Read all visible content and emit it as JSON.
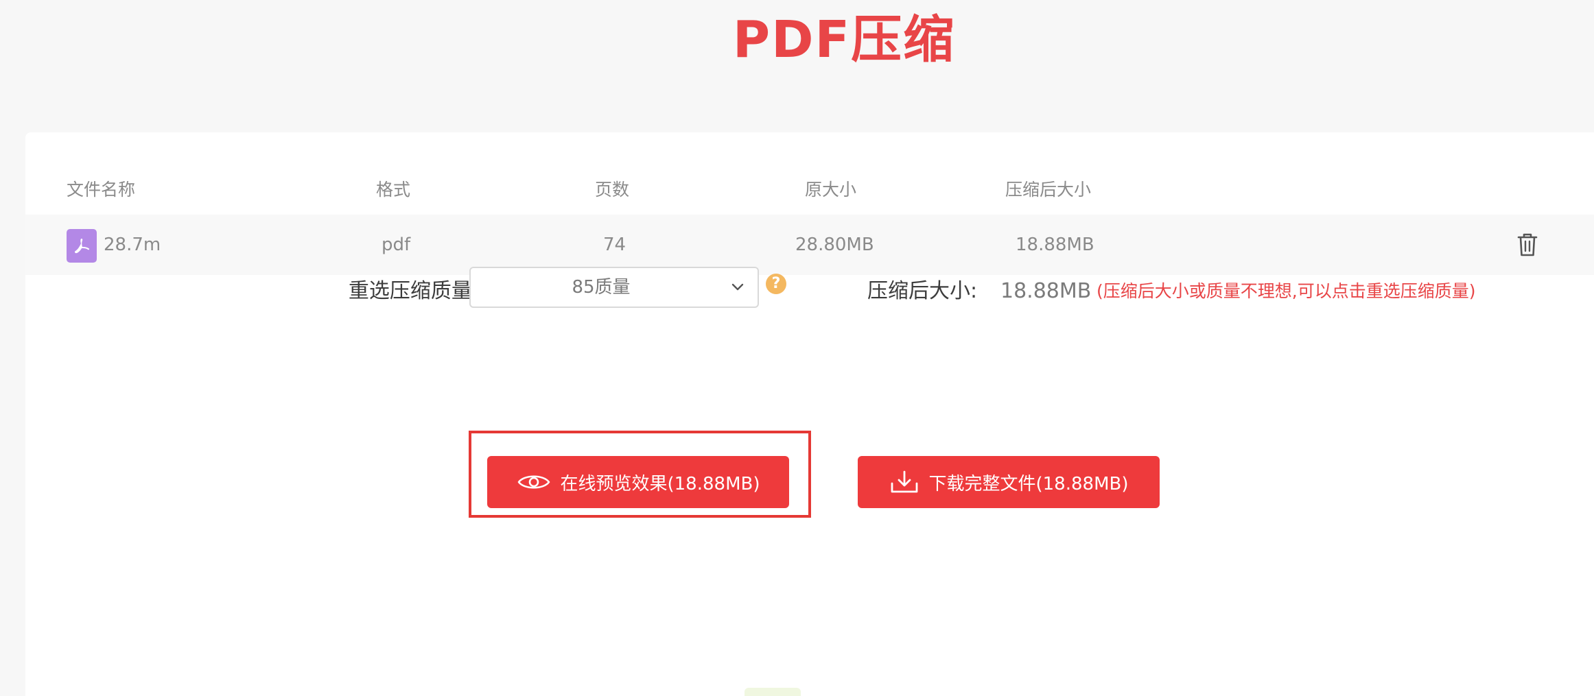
{
  "page": {
    "title": "PDF压缩"
  },
  "table": {
    "headers": {
      "name": "文件名称",
      "format": "格式",
      "pages": "页数",
      "original_size": "原大小",
      "compressed_size": "压缩后大小"
    },
    "rows": [
      {
        "name": "28.7m",
        "format": "pdf",
        "pages": "74",
        "original_size": "28.80MB",
        "compressed_size": "18.88MB",
        "icon": "pdf-file-icon",
        "action_icon": "trash-icon"
      }
    ]
  },
  "quality": {
    "label": "重选压缩质量:",
    "selected": "85质量",
    "help_glyph": "?"
  },
  "result": {
    "label": "压缩后大小:",
    "value": "18.88MB",
    "hint": "(压缩后大小或质量不理想,可以点击重选压缩质量)"
  },
  "actions": {
    "preview_label": "在线预览效果(18.88MB)",
    "preview_icon": "eye-icon",
    "download_label": "下载完整文件(18.88MB)",
    "download_icon": "download-icon"
  },
  "colors": {
    "brand_red": "#ee3a3c",
    "title_red": "#e84547",
    "pdf_icon_purple": "#b388e6",
    "help_orange": "#f4b860",
    "highlight_border": "#e53935"
  }
}
